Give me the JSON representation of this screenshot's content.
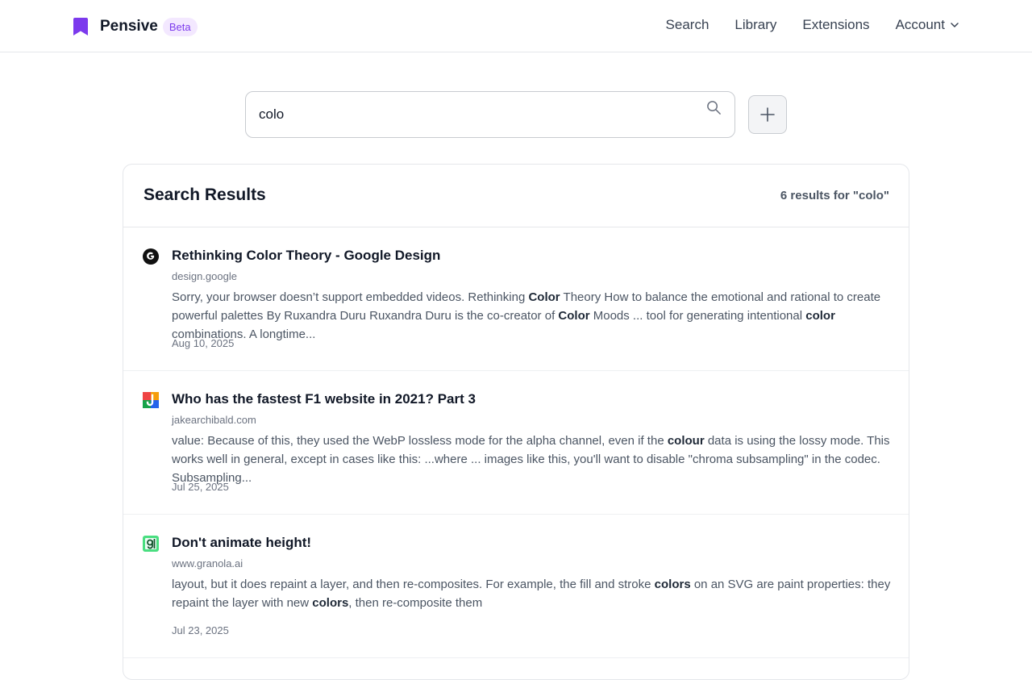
{
  "header": {
    "brand_name": "Pensive",
    "badge": "Beta",
    "brand_color": "#7c3aed",
    "nav": [
      {
        "label": "Search"
      },
      {
        "label": "Library"
      },
      {
        "label": "Extensions"
      },
      {
        "label": "Account",
        "icon": "chevron-down-icon"
      }
    ]
  },
  "search": {
    "value": "colo",
    "placeholder": "",
    "icon": "search-icon",
    "add_icon": "plus-icon"
  },
  "results_panel": {
    "title": "Search Results",
    "count_text": "6 results for \"colo\"",
    "results": [
      {
        "favicon": "google-g-icon",
        "title": "Rethinking Color Theory - Google Design",
        "domain": "design.google",
        "snippet_parts": [
          {
            "text": "Sorry, your browser doesn’t support embedded videos. Rethinking ",
            "bold": false
          },
          {
            "text": "Color",
            "bold": true
          },
          {
            "text": " Theory How to balance the emotional and rational to create powerful palettes By Ruxandra Duru Ruxandra Duru is the co-creator of ",
            "bold": false
          },
          {
            "text": "Color",
            "bold": true
          },
          {
            "text": " Moods ... tool for generating intentional ",
            "bold": false
          },
          {
            "text": "color",
            "bold": true
          },
          {
            "text": " combinations. A longtime...",
            "bold": false
          }
        ],
        "date": "Aug 10, 2025"
      },
      {
        "favicon": "jake-archibald-j-icon",
        "title": "Who has the fastest F1 website in 2021? Part 3",
        "domain": "jakearchibald.com",
        "snippet_parts": [
          {
            "text": "value: Because of this, they used the WebP lossless mode for the alpha channel, even if the ",
            "bold": false
          },
          {
            "text": "colour",
            "bold": true
          },
          {
            "text": " data is using the lossy mode. This works well in general, except in cases like this: ...where ... images like this, you'll want to disable \"chroma subsampling\" in the codec. Subsampling...",
            "bold": false
          }
        ],
        "date": "Jul 25, 2025"
      },
      {
        "favicon": "granola-g-icon",
        "title": "Don't animate height!",
        "domain": "www.granola.ai",
        "snippet_parts": [
          {
            "text": "layout, but it does repaint a layer, and then re-composites. For example, the fill and stroke ",
            "bold": false
          },
          {
            "text": "colors",
            "bold": true
          },
          {
            "text": " on an SVG are paint properties: they repaint the layer with new ",
            "bold": false
          },
          {
            "text": "colors",
            "bold": true
          },
          {
            "text": ", then re-composite them",
            "bold": false
          }
        ],
        "date": "Jul 23, 2025"
      }
    ]
  }
}
